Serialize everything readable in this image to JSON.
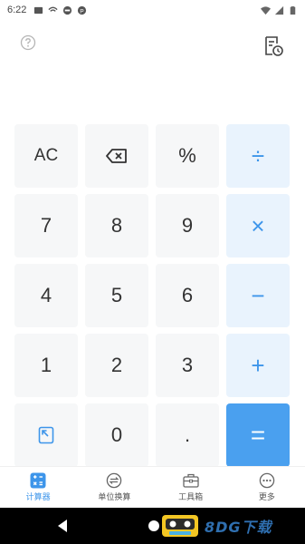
{
  "status_bar": {
    "time": "6:22",
    "icons": [
      "message-icon",
      "wifi-calling-icon",
      "do-not-disturb-icon",
      "app-notification-icon"
    ],
    "right_icons": [
      "wifi-icon",
      "signal-icon",
      "battery-icon"
    ]
  },
  "top": {
    "help_icon": "question-circle-icon",
    "history_icon": "history-document-icon"
  },
  "keypad": {
    "rows": [
      [
        {
          "label": "AC",
          "kind": "fn"
        },
        {
          "label": "",
          "kind": "fn",
          "icon": "backspace-icon"
        },
        {
          "label": "%",
          "kind": "fn"
        },
        {
          "label": "÷",
          "kind": "op"
        }
      ],
      [
        {
          "label": "7",
          "kind": "num"
        },
        {
          "label": "8",
          "kind": "num"
        },
        {
          "label": "9",
          "kind": "num"
        },
        {
          "label": "×",
          "kind": "op"
        }
      ],
      [
        {
          "label": "4",
          "kind": "num"
        },
        {
          "label": "5",
          "kind": "num"
        },
        {
          "label": "6",
          "kind": "num"
        },
        {
          "label": "−",
          "kind": "op"
        }
      ],
      [
        {
          "label": "1",
          "kind": "num"
        },
        {
          "label": "2",
          "kind": "num"
        },
        {
          "label": "3",
          "kind": "num"
        },
        {
          "label": "+",
          "kind": "op"
        }
      ],
      [
        {
          "label": "",
          "kind": "fn",
          "icon": "collapse-icon"
        },
        {
          "label": "0",
          "kind": "num"
        },
        {
          "label": ".",
          "kind": "num"
        },
        {
          "label": "=",
          "kind": "eq"
        }
      ]
    ]
  },
  "nav": {
    "items": [
      {
        "label": "计算器",
        "icon": "calculator-icon",
        "active": true
      },
      {
        "label": "单位换算",
        "icon": "unit-convert-icon",
        "active": false
      },
      {
        "label": "工具箱",
        "icon": "toolbox-icon",
        "active": false
      },
      {
        "label": "更多",
        "icon": "more-icon",
        "active": false
      }
    ]
  },
  "watermark": {
    "text": "8DG下载"
  },
  "colors": {
    "accent": "#3d95ea",
    "equals_bg": "#4aa0ef",
    "operator_bg": "#e9f3fd",
    "key_bg": "#f6f7f8"
  }
}
